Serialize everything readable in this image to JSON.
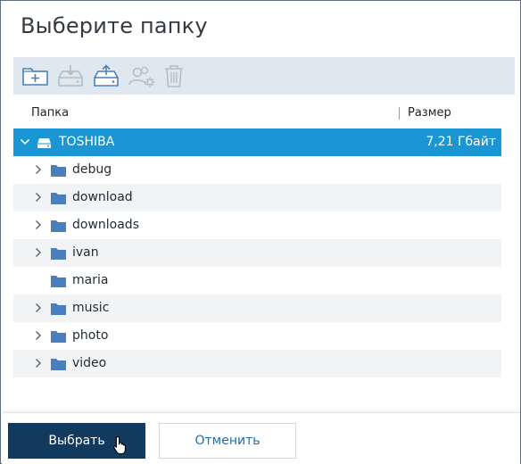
{
  "dialog": {
    "title": "Выберите папку"
  },
  "toolbar": {
    "buttons": [
      {
        "name": "new-folder",
        "icon": "folder-plus-icon",
        "enabled": true
      },
      {
        "name": "download",
        "icon": "drive-download-icon",
        "enabled": false
      },
      {
        "name": "upload",
        "icon": "drive-upload-icon",
        "enabled": true
      },
      {
        "name": "permissions",
        "icon": "users-gear-icon",
        "enabled": false
      },
      {
        "name": "delete",
        "icon": "trash-icon",
        "enabled": false
      }
    ]
  },
  "table": {
    "columns": {
      "folder": "Папка",
      "size": "Размер"
    },
    "root": {
      "label": "TOSHIBA",
      "size": "7,21 Гбайт",
      "icon": "drive-icon",
      "expanded": true
    },
    "rows": [
      {
        "label": "debug",
        "expandable": true
      },
      {
        "label": "download",
        "expandable": true
      },
      {
        "label": "downloads",
        "expandable": true
      },
      {
        "label": "ivan",
        "expandable": true
      },
      {
        "label": "maria",
        "expandable": false
      },
      {
        "label": "music",
        "expandable": true
      },
      {
        "label": "photo",
        "expandable": true
      },
      {
        "label": "video",
        "expandable": true
      }
    ]
  },
  "footer": {
    "select_label": "Выбрать",
    "cancel_label": "Отменить"
  },
  "colors": {
    "accent": "#1a96d4",
    "primary_button": "#12395e",
    "folder": "#4a7fbf",
    "toolbar_bg": "#dfe7ef"
  }
}
